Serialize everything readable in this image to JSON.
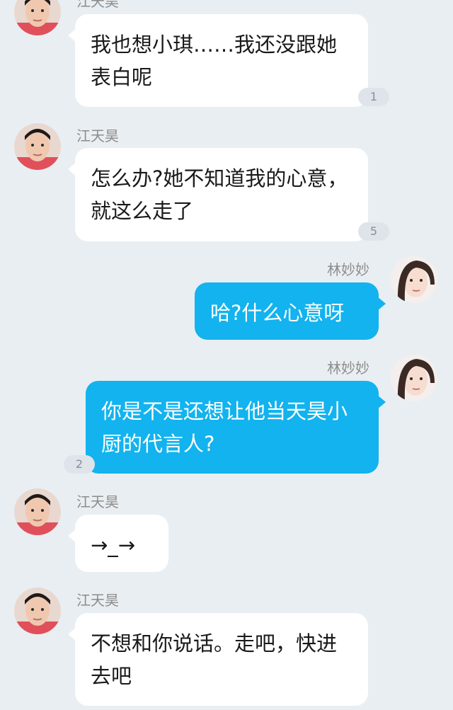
{
  "messages": [
    {
      "sender": "江天昊",
      "side": "left",
      "text": "我也想小琪……我还没跟她表白呢",
      "badge": "1"
    },
    {
      "sender": "江天昊",
      "side": "left",
      "text": "怎么办?她不知道我的心意，就这么走了",
      "badge": "5"
    },
    {
      "sender": "林妙妙",
      "side": "right",
      "text": "哈?什么心意呀",
      "badge": ""
    },
    {
      "sender": "林妙妙",
      "side": "right",
      "text": "你是不是还想让他当天昊小厨的代言人?",
      "badge": "2"
    },
    {
      "sender": "江天昊",
      "side": "left",
      "text": "→_→",
      "badge": ""
    },
    {
      "sender": "江天昊",
      "side": "left",
      "text": "不想和你说话。走吧，快进去吧",
      "badge": ""
    }
  ],
  "colors": {
    "background": "#e9eef2",
    "left_bubble": "#ffffff",
    "right_bubble": "#12b3ee",
    "name_text": "#8c8c8c"
  },
  "icons": {
    "left_avatar": "boy-avatar-icon",
    "right_avatar": "girl-avatar-icon"
  }
}
